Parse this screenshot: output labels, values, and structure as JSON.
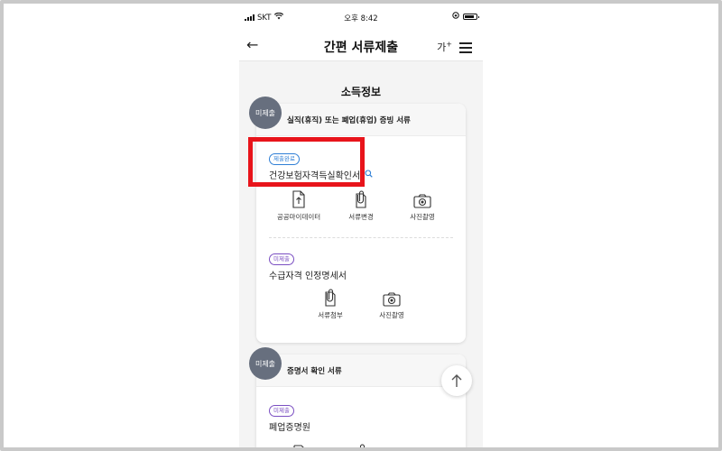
{
  "status_bar": {
    "carrier": "SKT",
    "time": "오후 8:42"
  },
  "header": {
    "title": "간편 서류제출",
    "font_size_label": "가",
    "font_size_sup": "+"
  },
  "section_title": "소득정보",
  "cards": [
    {
      "badge": "미제출",
      "heading": "실직(휴직) 또는 폐업(휴업) 증빙 서류",
      "documents": [
        {
          "status": "제출완료",
          "name": "건강보험자격득실확인서",
          "actions": [
            "공공마이데이터",
            "서류변경",
            "사진촬영"
          ]
        },
        {
          "status": "미제출",
          "name": "수급자격 인정명세서",
          "actions": [
            "서류첨부",
            "사진촬영"
          ]
        }
      ]
    },
    {
      "badge": "미제출",
      "heading": "증명서 확인 서류",
      "documents": [
        {
          "status": "미제출",
          "name": "폐업증명원"
        }
      ]
    }
  ],
  "icons": {
    "back": "arrow-left-icon",
    "menu": "hamburger-menu-icon",
    "search": "magnifier-icon",
    "scroll_top": "arrow-up-icon"
  },
  "colors": {
    "submitted": "#2f7fd6",
    "pending": "#7b4fc2",
    "badge_bg": "#676f7e",
    "highlight": "#e8141b"
  }
}
